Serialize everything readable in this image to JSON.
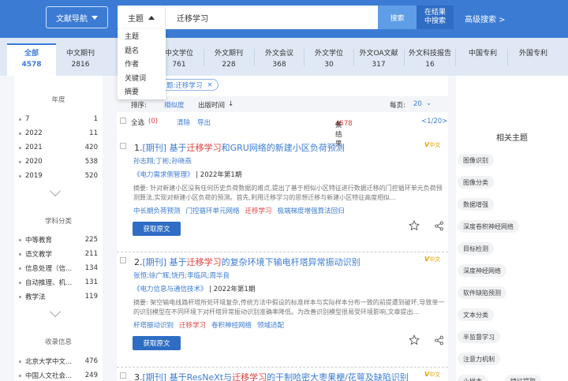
{
  "header": {
    "nav_label": "文献导航",
    "field_selected": "主题",
    "search_value": "迁移学习",
    "search_btn": "搜索",
    "inresult_line1": "在结果",
    "inresult_line2": "中搜索",
    "advanced": "高级搜索 >"
  },
  "field_options": [
    "主题",
    "题名",
    "作者",
    "关键词",
    "摘要"
  ],
  "tabs": [
    {
      "label": "全部",
      "count": "4578"
    },
    {
      "label": "中文期刊",
      "count": "2816"
    },
    {
      "label": "中文学位",
      "count": "761"
    },
    {
      "label": "外文期刊",
      "count": "228"
    },
    {
      "label": "外文会议",
      "count": "368"
    },
    {
      "label": "外文学位",
      "count": "30"
    },
    {
      "label": "外文OA文献",
      "count": "317"
    },
    {
      "label": "外文科技报告",
      "count": "16"
    },
    {
      "label": "中国专利",
      "count": ""
    },
    {
      "label": "外国专利",
      "count": ""
    }
  ],
  "left": {
    "year_title": "年度",
    "years": [
      {
        "label": "7",
        "count": "1"
      },
      {
        "label": "2022",
        "count": "11"
      },
      {
        "label": "2021",
        "count": "420"
      },
      {
        "label": "2020",
        "count": "538"
      },
      {
        "label": "2019",
        "count": "520"
      }
    ],
    "subject_title": "学科分类",
    "subjects": [
      {
        "label": "中等教育",
        "count": "225"
      },
      {
        "label": "语文教学",
        "count": "211"
      },
      {
        "label": "信息处理（信...",
        "count": "134"
      },
      {
        "label": "自动推理、机...",
        "count": "131"
      },
      {
        "label": "教学法",
        "count": "119"
      }
    ],
    "source_title": "收录信息",
    "sources": [
      {
        "label": "北京大学中文...",
        "count": "476"
      },
      {
        "label": "中国人文社会...",
        "count": "249"
      }
    ]
  },
  "filter": {
    "crumb": "题:迁移学习",
    "crumb_close": "×"
  },
  "sortbar": {
    "sort_label": "排序:",
    "relevance": "相似度",
    "pubtime": "出版时间",
    "pubtime_arrow": "↓",
    "perpage_label": "每页:",
    "perpage_value": "20"
  },
  "selectbar": {
    "select_all": "全选",
    "selected_count": "(0)",
    "clear": "清除",
    "export": "导出",
    "total_prefix": "共",
    "total_count": "4578",
    "total_suffix": "条结果",
    "pager": "<1/20>"
  },
  "results": [
    {
      "num": "1.",
      "type": "[期刊]",
      "title_pre": " 基于",
      "title_kw": "迁移学习",
      "title_post": "和GRU网络的新建小区负荷预测",
      "authors": "孙志翔;丁彬;孙晓燕",
      "source_name": "《电力需求侧管理》",
      "source_year": "| 2022年第1期",
      "abstract": "摘要: 针对新建小区没有任何历史负荷数据的难点,提出了基于相似小区特征进行数据迁移的门控循环单元负荷预测算法,实现对新建小区负荷的预测。首先,利用迁移学习的思想迁移与新建小区特征高度相似...",
      "keywords": [
        "中长期负荷预测",
        "门控循环单元网络",
        "迁移学习",
        "极端梯度增强算法回归"
      ],
      "button": "获取原文",
      "badge": "V",
      "badge_sub": "中文"
    },
    {
      "num": "2.",
      "type": "[期刊]",
      "title_pre": " 基于",
      "title_kw": "迁移学习",
      "title_post": "的复杂环境下输电杆塔异常振动识别",
      "authors": "张恒;徐广辉;饶丹;李临风;周华良",
      "source_name": "《电力信息与通信技术》",
      "source_year": "| 2022年第1期",
      "abstract": "摘要: 架空输电线路杆塔所处环境复杂,传统方法中假设的标准样本与实际样本分布一致的前提遭到破坏,导致单一的识别模型在不同环境下对杆塔异常振动识别准确率降低。为改善识别模型很易受环境影响,文章提出...",
      "keywords": [
        "杆塔振动识别",
        "迁移学习",
        "卷积神经网络",
        "领域适配"
      ],
      "button": "获取原文",
      "badge": "V",
      "badge_sub": "中文"
    },
    {
      "num": "3.",
      "type": "[期刊]",
      "title_pre": " 基于ResNeXt与",
      "title_kw": "迁移学习",
      "title_post": "的干制哈密大枣果梗/花萼及缺陷识别",
      "badge": "V",
      "badge_sub": "中文"
    }
  ],
  "right": {
    "title": "相关主题",
    "topics": [
      "图像识别",
      "图像分类",
      "数据增强",
      "深度卷积神经网络",
      "目标检测",
      "深度神经网络",
      "软件缺陷预测",
      "文本分类",
      "半监督学习",
      "注意力机制",
      "小样本",
      "特征提取"
    ]
  }
}
